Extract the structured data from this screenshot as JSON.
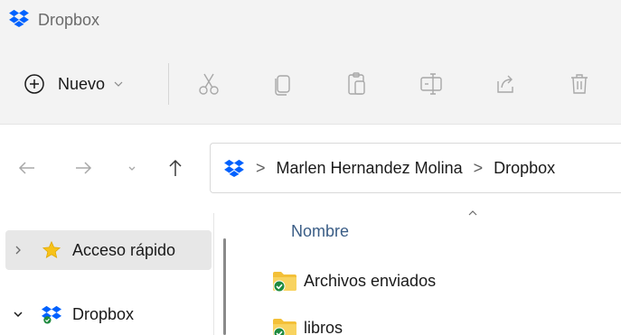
{
  "window": {
    "title": "Dropbox"
  },
  "toolbar": {
    "new_label": "Nuevo",
    "icons": [
      "cut-icon",
      "copy-icon",
      "paste-icon",
      "rename-icon",
      "share-icon",
      "delete-icon"
    ]
  },
  "navigation": {
    "icons": [
      "back-arrow-icon",
      "forward-arrow-icon",
      "recent-chevron-icon",
      "up-arrow-icon"
    ]
  },
  "address": {
    "crumbs": [
      "Marlen Hernandez Molina",
      "Dropbox"
    ],
    "separator": ">"
  },
  "sidebar": {
    "items": [
      {
        "label": "Acceso rápido",
        "icon": "star-icon",
        "expanded": false,
        "selected": true
      },
      {
        "label": "Dropbox",
        "icon": "dropbox-icon",
        "expanded": true,
        "selected": false
      }
    ]
  },
  "file_list": {
    "column_name": "Nombre",
    "files": [
      {
        "name": "Archivos enviados",
        "icon": "synced-folder-icon"
      },
      {
        "name": "libros",
        "icon": "synced-folder-icon"
      }
    ]
  },
  "colors": {
    "dropbox_blue": "#0061fe",
    "star_yellow": "#f7c21a",
    "folder_yellow": "#f3c038",
    "sync_green": "#1e8a3e",
    "column_header": "#3a5d86"
  }
}
